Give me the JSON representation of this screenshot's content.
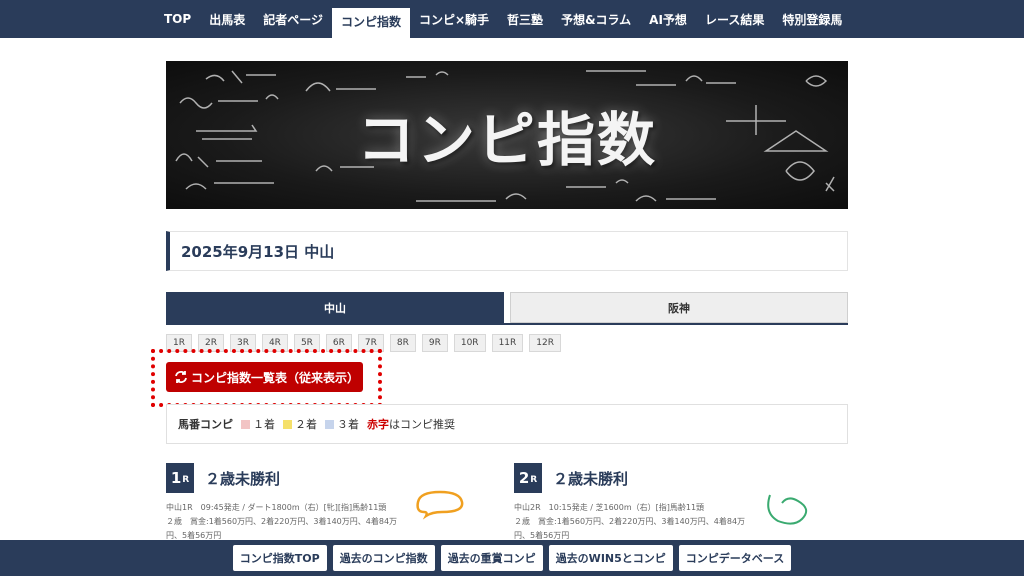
{
  "nav": {
    "items": [
      {
        "label": "TOP"
      },
      {
        "label": "出馬表"
      },
      {
        "label": "記者ページ"
      },
      {
        "label": "コンピ指数"
      },
      {
        "label": "コンピ×騎手"
      },
      {
        "label": "哲三塾"
      },
      {
        "label": "予想&コラム"
      },
      {
        "label": "AI予想"
      },
      {
        "label": "レース結果"
      },
      {
        "label": "特別登録馬"
      }
    ],
    "active": "コンピ指数"
  },
  "banner": {
    "title": "コンピ指数"
  },
  "date_heading": "2025年9月13日 中山",
  "venue_tabs": [
    {
      "label": "中山",
      "active": true
    },
    {
      "label": "阪神",
      "active": false
    }
  ],
  "races": [
    "1R",
    "2R",
    "3R",
    "4R",
    "5R",
    "6R",
    "7R",
    "8R",
    "9R",
    "10R",
    "11R",
    "12R"
  ],
  "list_button": {
    "label": "コンピ指数一覧表（従来表示）",
    "icon": "refresh-icon"
  },
  "legend": {
    "label": "馬番コンピ",
    "items": [
      {
        "text": "１着",
        "color": "#f2c4c4"
      },
      {
        "text": "２着",
        "color": "#f5e06a"
      },
      {
        "text": "３着",
        "color": "#c6d4ec"
      }
    ],
    "note_red": "赤字",
    "note_rest": "はコンピ推奨"
  },
  "race_cards": [
    {
      "num": "1",
      "suffix": "R",
      "name": "２歳未勝利",
      "info1": "中山1R　09:45発走 / ダート1800m（右）[牝][指]馬齢11頭",
      "info2": "２歳　賞金:1着560万円、2着220万円、3着140万円、4着84万",
      "info3": "円、5着56万円"
    },
    {
      "num": "2",
      "suffix": "R",
      "name": "２歳未勝利",
      "info1": "中山2R　10:15発走 / 芝1600m（右）[指]馬齢11頭",
      "info2": "２歳　賞金:1着560万円、2着220万円、3着140万円、4着84万",
      "info3": "円、5着56万円"
    }
  ],
  "bottom_nav": [
    {
      "label": "コンピ指数TOP"
    },
    {
      "label": "過去のコンピ指数"
    },
    {
      "label": "過去の重賞コンピ"
    },
    {
      "label": "過去のWIN5とコンピ"
    },
    {
      "label": "コンピデータベース"
    }
  ],
  "colors": {
    "navy": "#2a3c5a",
    "red": "#bf0000",
    "highlight": "#e00000"
  }
}
